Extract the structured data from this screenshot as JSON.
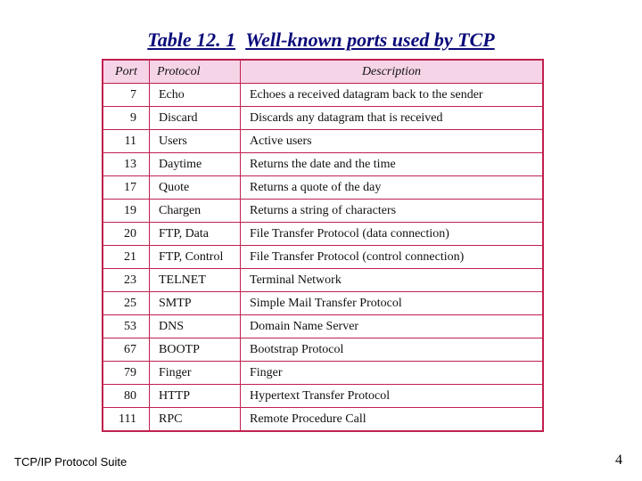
{
  "title_number": "Table 12. 1",
  "title_caption": "Well-known ports used by TCP",
  "headers": {
    "port": "Port",
    "protocol": "Protocol",
    "description": "Description"
  },
  "rows": [
    {
      "port": "7",
      "protocol": "Echo",
      "description": "Echoes a received datagram back to the sender"
    },
    {
      "port": "9",
      "protocol": "Discard",
      "description": "Discards any datagram that is received"
    },
    {
      "port": "11",
      "protocol": "Users",
      "description": "Active users"
    },
    {
      "port": "13",
      "protocol": "Daytime",
      "description": "Returns the date and the time"
    },
    {
      "port": "17",
      "protocol": "Quote",
      "description": "Returns a quote of the day"
    },
    {
      "port": "19",
      "protocol": "Chargen",
      "description": "Returns a string of characters"
    },
    {
      "port": "20",
      "protocol": "FTP, Data",
      "description": "File Transfer Protocol (data connection)"
    },
    {
      "port": "21",
      "protocol": "FTP, Control",
      "description": "File Transfer Protocol (control connection)"
    },
    {
      "port": "23",
      "protocol": "TELNET",
      "description": "Terminal Network"
    },
    {
      "port": "25",
      "protocol": "SMTP",
      "description": "Simple Mail Transfer Protocol"
    },
    {
      "port": "53",
      "protocol": "DNS",
      "description": "Domain Name Server"
    },
    {
      "port": "67",
      "protocol": "BOOTP",
      "description": "Bootstrap Protocol"
    },
    {
      "port": "79",
      "protocol": "Finger",
      "description": "Finger"
    },
    {
      "port": "80",
      "protocol": "HTTP",
      "description": "Hypertext Transfer Protocol"
    },
    {
      "port": "111",
      "protocol": "RPC",
      "description": "Remote Procedure Call"
    }
  ],
  "footer_left": "TCP/IP Protocol Suite",
  "page_number": "4",
  "chart_data": {
    "type": "table",
    "title": "Table 12.1 Well-known ports used by TCP",
    "columns": [
      "Port",
      "Protocol",
      "Description"
    ],
    "rows": [
      [
        "7",
        "Echo",
        "Echoes a received datagram back to the sender"
      ],
      [
        "9",
        "Discard",
        "Discards any datagram that is received"
      ],
      [
        "11",
        "Users",
        "Active users"
      ],
      [
        "13",
        "Daytime",
        "Returns the date and the time"
      ],
      [
        "17",
        "Quote",
        "Returns a quote of the day"
      ],
      [
        "19",
        "Chargen",
        "Returns a string of characters"
      ],
      [
        "20",
        "FTP, Data",
        "File Transfer Protocol (data connection)"
      ],
      [
        "21",
        "FTP, Control",
        "File Transfer Protocol (control connection)"
      ],
      [
        "23",
        "TELNET",
        "Terminal Network"
      ],
      [
        "25",
        "SMTP",
        "Simple Mail Transfer Protocol"
      ],
      [
        "53",
        "DNS",
        "Domain Name Server"
      ],
      [
        "67",
        "BOOTP",
        "Bootstrap Protocol"
      ],
      [
        "79",
        "Finger",
        "Finger"
      ],
      [
        "80",
        "HTTP",
        "Hypertext Transfer Protocol"
      ],
      [
        "111",
        "RPC",
        "Remote Procedure Call"
      ]
    ]
  }
}
